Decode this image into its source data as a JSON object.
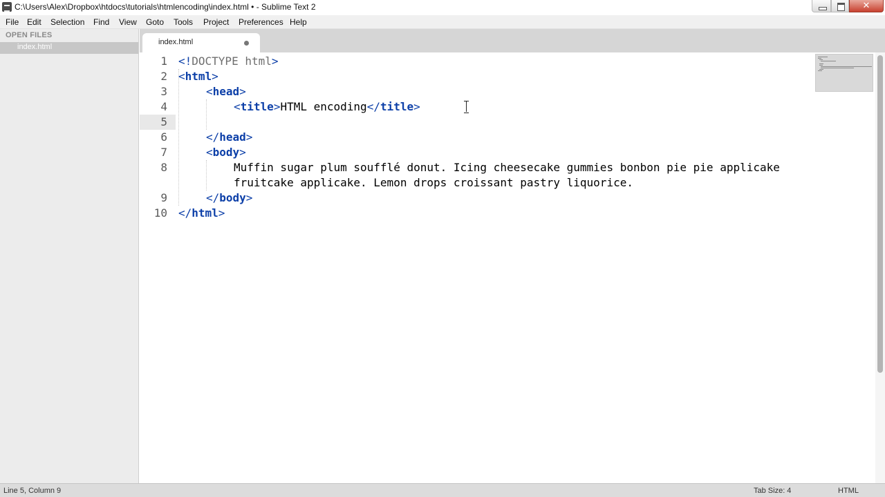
{
  "window": {
    "title": "C:\\Users\\Alex\\Dropbox\\htdocs\\tutorials\\htmlencoding\\index.html • - Sublime Text 2",
    "close_glyph": "✕"
  },
  "menu": {
    "items": [
      "File",
      "Edit",
      "Selection",
      "Find",
      "View",
      "Goto",
      "Tools",
      "Project",
      "Preferences",
      "Help"
    ]
  },
  "sidebar": {
    "heading": "OPEN FILES",
    "files": [
      {
        "label": "index.html",
        "selected": true
      }
    ]
  },
  "tabs": [
    {
      "label": "index.html",
      "dirty": true,
      "active": true
    }
  ],
  "editor": {
    "language": "HTML",
    "current_line": 5,
    "gutter": [
      "1",
      "2",
      "3",
      "4",
      "5",
      "6",
      "7",
      "8",
      "",
      "9",
      "10"
    ],
    "code": {
      "l1": {
        "open": "<!",
        "doctype": "DOCTYPE html",
        "close": ">"
      },
      "l2": {
        "lt": "<",
        "tag": "html",
        "gt": ">"
      },
      "l3": {
        "lt": "<",
        "tag": "head",
        "gt": ">"
      },
      "l4": {
        "lt": "<",
        "tag": "title",
        "gt": ">",
        "text": "HTML encoding",
        "lt2": "</",
        "tag2": "title",
        "gt2": ">"
      },
      "l6": {
        "lt": "</",
        "tag": "head",
        "gt": ">"
      },
      "l7": {
        "lt": "<",
        "tag": "body",
        "gt": ">"
      },
      "l8a": "Muffin sugar plum soufflé donut. Icing cheesecake gummies bonbon pie pie applicake",
      "l8b": "fruitcake applicake. Lemon drops croissant pastry liquorice.",
      "l9": {
        "lt": "</",
        "tag": "body",
        "gt": ">"
      },
      "l10": {
        "lt": "</",
        "tag": "html",
        "gt": ">"
      }
    }
  },
  "status": {
    "position": "Line 5, Column 9",
    "tab_size": "Tab Size: 4",
    "syntax": "HTML"
  },
  "colors": {
    "tag": "#0c3fa8",
    "doctype": "#6e6e6e",
    "sidebar_bg": "#ececec",
    "tabbar_bg": "#d6d6d6",
    "close_button": "#c8412f"
  },
  "icons": {
    "app": "sublime-text-icon",
    "minimize": "minimize-icon",
    "maximize": "maximize-icon",
    "close": "close-icon",
    "dirty": "unsaved-dot-icon",
    "cursor": "text-cursor-icon"
  }
}
